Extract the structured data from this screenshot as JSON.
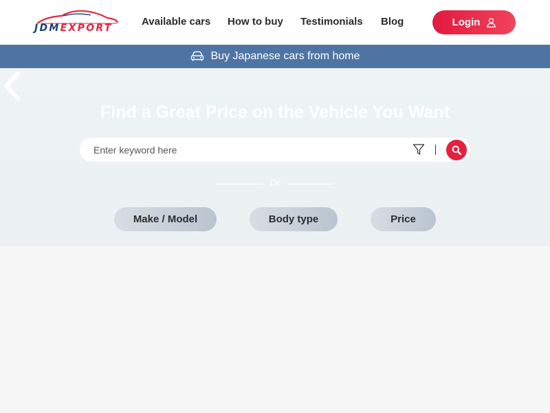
{
  "header": {
    "logo": {
      "part1": "JDM",
      "part2": "EXPORT"
    },
    "nav": [
      {
        "label": "Available cars"
      },
      {
        "label": "How to buy"
      },
      {
        "label": "Testimonials"
      },
      {
        "label": "Blog"
      }
    ],
    "login_label": "Login"
  },
  "banner": {
    "icon": "car-icon",
    "text": "Buy Japanese cars from home"
  },
  "hero": {
    "title": "Find a Great Price on the Vehicle You Want",
    "search": {
      "placeholder": "Enter keyword here",
      "value": ""
    },
    "or_text": "Or",
    "filters": [
      {
        "label": "Make / Model"
      },
      {
        "label": "Body type"
      },
      {
        "label": "Price"
      }
    ]
  },
  "colors": {
    "brand_red": "#e5203f",
    "brand_blue": "#1c3f77",
    "banner_blue": "#4e74a3"
  }
}
